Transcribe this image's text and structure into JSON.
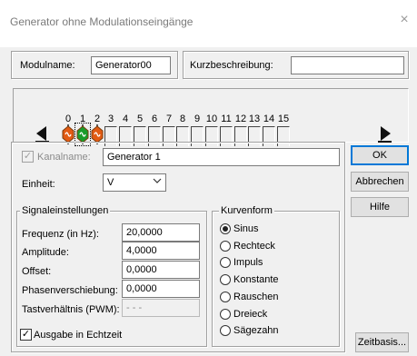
{
  "window": {
    "title": "Generator ohne Modulationseingänge",
    "close_glyph": "×"
  },
  "module": {
    "name_label": "Modulname:",
    "name_value": "Generator00",
    "desc_label": "Kurzbeschreibung:",
    "desc_value": ""
  },
  "channels": {
    "numbers": [
      "0",
      "1",
      "2",
      "3",
      "4",
      "5",
      "6",
      "7",
      "8",
      "9",
      "10",
      "11",
      "12",
      "13",
      "14",
      "15"
    ],
    "active": [
      0,
      1,
      2
    ],
    "selected": 1,
    "colors": {
      "active_glyph": "#e25b13",
      "selected_glyph": "#1a9c2a",
      "glyph_border": "#7a3a0a"
    }
  },
  "channel": {
    "enabled_label": "Kanalname:",
    "name_value": "Generator 1",
    "unit_label": "Einheit:",
    "unit_value": "V"
  },
  "signal": {
    "group_label": "Signaleinstellungen",
    "fields": [
      {
        "label": "Frequenz (in Hz):",
        "value": "20,0000"
      },
      {
        "label": "Amplitude:",
        "value": "4,0000"
      },
      {
        "label": "Offset:",
        "value": "0,0000"
      },
      {
        "label": "Phasenverschiebung:",
        "value": "0,0000"
      },
      {
        "label": "Tastverhältnis (PWM):",
        "value": "- - -"
      }
    ],
    "realtime_label": "Ausgabe in Echtzeit"
  },
  "waveform": {
    "group_label": "Kurvenform",
    "options": [
      "Sinus",
      "Rechteck",
      "Impuls",
      "Konstante",
      "Rauschen",
      "Dreieck",
      "Sägezahn"
    ],
    "selected": "Sinus"
  },
  "buttons": {
    "ok": "OK",
    "cancel": "Abbrechen",
    "help": "Hilfe",
    "timebase": "Zeitbasis..."
  }
}
